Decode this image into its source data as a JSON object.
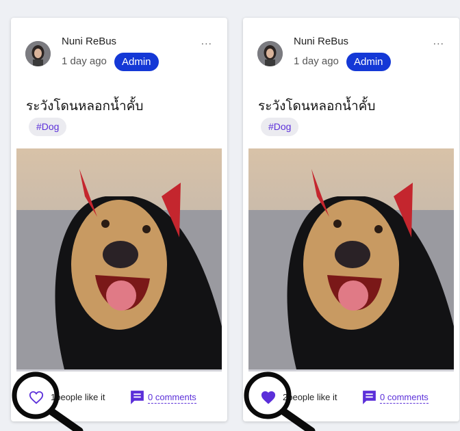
{
  "cards": [
    {
      "author": "Nuni ReBus",
      "time": "1 day ago",
      "badge": "Admin",
      "more": "...",
      "title": "ระวังโดนหลอกน้ำคั้บ",
      "tag": "#Dog",
      "likes_text": "people like it",
      "likes_count_visible": "1",
      "liked": false,
      "comments_text": "0 comments"
    },
    {
      "author": "Nuni ReBus",
      "time": "1 day ago",
      "badge": "Admin",
      "more": "...",
      "title": "ระวังโดนหลอกน้ำคั้บ",
      "tag": "#Dog",
      "likes_text": "people like it",
      "likes_count_visible": "2",
      "liked": true,
      "comments_text": "0 comments"
    }
  ],
  "colors": {
    "accent": "#5b2fd9",
    "badge": "#1438d6"
  },
  "icons": {
    "like_empty": "heart-outline-icon",
    "like_filled": "heart-filled-icon",
    "comment": "comment-icon",
    "more": "more-horizontal-icon"
  }
}
